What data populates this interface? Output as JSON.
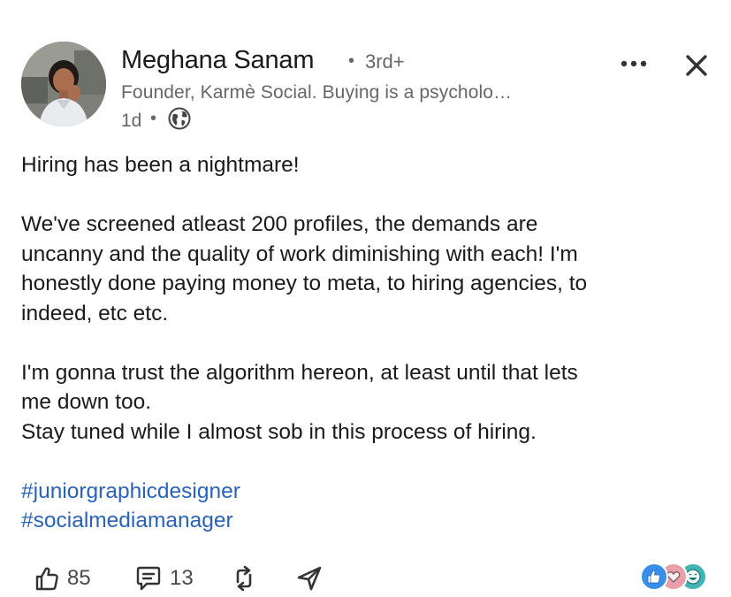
{
  "author": {
    "name": "Meghana Sanam",
    "degree": "3rd+",
    "headline": "Founder, Karmè Social. Buying is a psycholo…",
    "time": "1d",
    "separator": "•"
  },
  "post": {
    "paragraphs": [
      [
        "Hiring has been a nightmare!"
      ],
      [
        "We've screened atleast 200 profiles, the demands are",
        "uncanny and the quality of work diminishing with each! I'm",
        "honestly done paying money to meta, to hiring agencies, to",
        "indeed, etc etc."
      ],
      [
        "I'm gonna trust the algorithm hereon, at least until that lets",
        "me down too.",
        "Stay tuned while I almost sob in this process of hiring."
      ]
    ],
    "hashtags": [
      "#juniorgraphicdesigner",
      "#socialmediamanager"
    ]
  },
  "actions": {
    "likes": "85",
    "comments": "13"
  },
  "icons": {
    "more": "more-horizontal-icon",
    "close": "close-icon",
    "visibility": "globe-icon",
    "like": "thumbs-up-icon",
    "comment": "comment-icon",
    "repost": "repost-icon",
    "send": "send-icon"
  },
  "colors": {
    "link": "#2a62b9",
    "secondary_text": "#666666",
    "primary_text": "#1a1a1a",
    "like_reaction": "#378fe9",
    "love_reaction": "#e8a0a8",
    "funny_reaction": "#44b3b3"
  }
}
